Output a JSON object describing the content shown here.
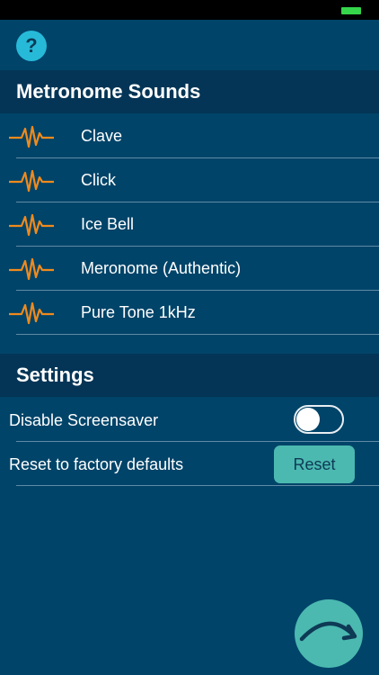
{
  "help": {
    "label": "?"
  },
  "sections": {
    "sounds_title": "Metronome Sounds",
    "settings_title": "Settings"
  },
  "sounds": [
    {
      "label": "Clave",
      "icon": "waveform-icon"
    },
    {
      "label": "Click",
      "icon": "waveform-icon"
    },
    {
      "label": "Ice Bell",
      "icon": "waveform-icon"
    },
    {
      "label": "Meronome (Authentic)",
      "icon": "waveform-icon"
    },
    {
      "label": "Pure Tone 1kHz",
      "icon": "waveform-icon"
    }
  ],
  "settings": {
    "disable_screensaver": {
      "label": "Disable Screensaver",
      "enabled": false
    },
    "reset": {
      "label": "Reset to factory defaults",
      "button_label": "Reset"
    }
  },
  "colors": {
    "background": "#014469",
    "header": "#043556",
    "accent_teal": "#4bb9b0",
    "help_blue": "#27bad8",
    "waveform_orange": "#f08a1c"
  },
  "icons": {
    "help": "question-mark-icon",
    "sound": "waveform-icon",
    "next": "curved-arrow-icon"
  }
}
